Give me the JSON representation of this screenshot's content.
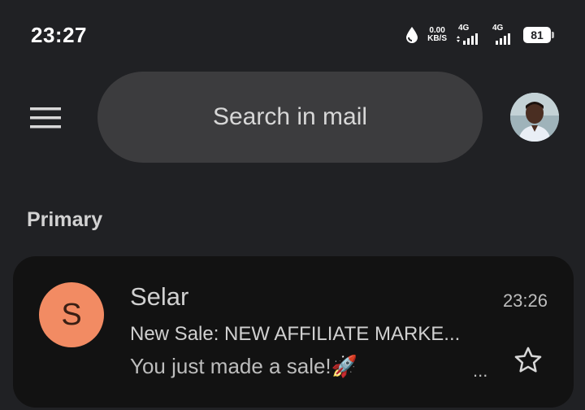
{
  "status_bar": {
    "time": "23:27",
    "speed_value": "0.00",
    "speed_unit": "KB/S",
    "signal1_label": "4G",
    "signal2_label": "4G",
    "battery_level": "81",
    "icons": [
      "data-saver-drop-icon",
      "network-speed-icon",
      "signal-icon",
      "signal-icon",
      "battery-icon"
    ]
  },
  "search": {
    "placeholder": "Search in mail"
  },
  "section": {
    "label": "Primary"
  },
  "emails": [
    {
      "avatar_letter": "S",
      "avatar_color": "#f28b63",
      "sender": "Selar",
      "time": "23:26",
      "subject": "New Sale: NEW AFFILIATE MARKE...",
      "snippet": "You just made a sale!",
      "snippet_emoji": "🚀",
      "more": "...",
      "starred": false
    }
  ],
  "colors": {
    "background": "#202124",
    "search_background": "#3c3c3e",
    "email_row_background": "#121212"
  }
}
